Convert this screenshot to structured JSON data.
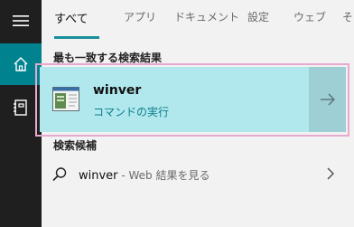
{
  "tabs": [
    {
      "label": "すべて",
      "active": true
    },
    {
      "label": "アプリ",
      "active": false
    },
    {
      "label": "ドキュメント",
      "active": false
    },
    {
      "label": "設定",
      "active": false
    },
    {
      "label": "ウェブ",
      "active": false
    },
    {
      "label": "そ",
      "active": false
    }
  ],
  "sections": {
    "best_match_title": "最も一致する検索結果",
    "suggestions_title": "検索候補"
  },
  "best_match": {
    "name": "winver",
    "subtitle": "コマンドの実行",
    "icon": "window-app-icon",
    "action_icon": "arrow-right-icon"
  },
  "suggestion": {
    "query": "winver",
    "hint": " - Web 結果を見る",
    "icon": "search-icon"
  },
  "colors": {
    "accent": "#1a8e9a",
    "rail_bg": "#1f1f1f",
    "rail_active": "#00838f",
    "card_bg": "#b1e8ee",
    "card_arrow_bg": "#9dcfd5",
    "highlight_border": "#e7a9cd"
  }
}
